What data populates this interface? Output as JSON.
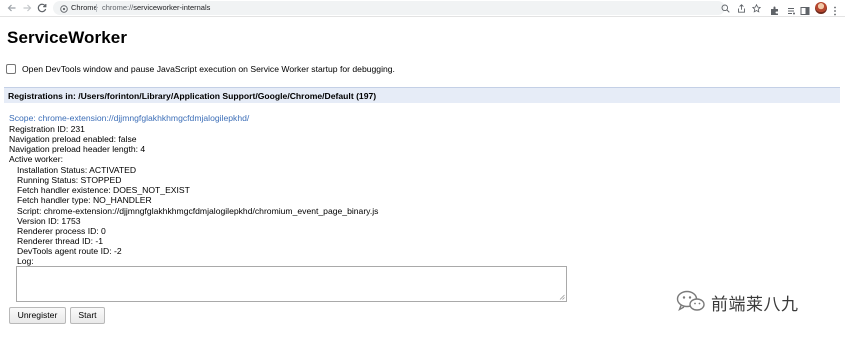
{
  "browser": {
    "chip_label": "Chrome",
    "url_scheme": "chrome://",
    "url_path": "serviceworker-internals",
    "icons": [
      "back-arrow-icon",
      "forward-arrow-icon",
      "reload-icon",
      "site-info-icon",
      "zoom-icon",
      "share-icon",
      "bookmark-star-icon",
      "extension-icon",
      "puzzle-icon",
      "queue-icon",
      "split-view-icon",
      "profile-avatar",
      "menu-dots-icon"
    ]
  },
  "page": {
    "title": "ServiceWorker",
    "debug_checkbox_label": "Open DevTools window and pause JavaScript execution on Service Worker startup for debugging.",
    "debug_checkbox_checked": false,
    "registrations_header": "Registrations in: /Users/forinton/Library/Application Support/Google/Chrome/Default (197)"
  },
  "registration": {
    "scope": "Scope: chrome-extension://djjmngfglakhkhmgcfdmjalogilepkhd/",
    "registration_id": "Registration ID: 231",
    "nav_preload_enabled": "Navigation preload enabled: false",
    "nav_preload_header_length": "Navigation preload header length: 4",
    "active_worker_label": "Active worker:",
    "installation_status": "Installation Status: ACTIVATED",
    "running_status": "Running Status: STOPPED",
    "fetch_handler_existence": "Fetch handler existence: DOES_NOT_EXIST",
    "fetch_handler_type": "Fetch handler type: NO_HANDLER",
    "script": "Script: chrome-extension://djjmngfglakhkhmgcfdmjalogilepkhd/chromium_event_page_binary.js",
    "version_id": "Version ID: 1753",
    "renderer_process_id": "Renderer process ID: 0",
    "renderer_thread_id": "Renderer thread ID: -1",
    "devtools_agent_route_id": "DevTools agent route ID: -2",
    "log_label": "Log:",
    "log_value": ""
  },
  "buttons": {
    "unregister": "Unregister",
    "start": "Start"
  },
  "watermark": {
    "text": "前端莱八九"
  },
  "colors": {
    "scope_link": "#3d6fb8",
    "header_band": "#e6ecf7",
    "omnibox_bg": "#f1f3f4"
  }
}
